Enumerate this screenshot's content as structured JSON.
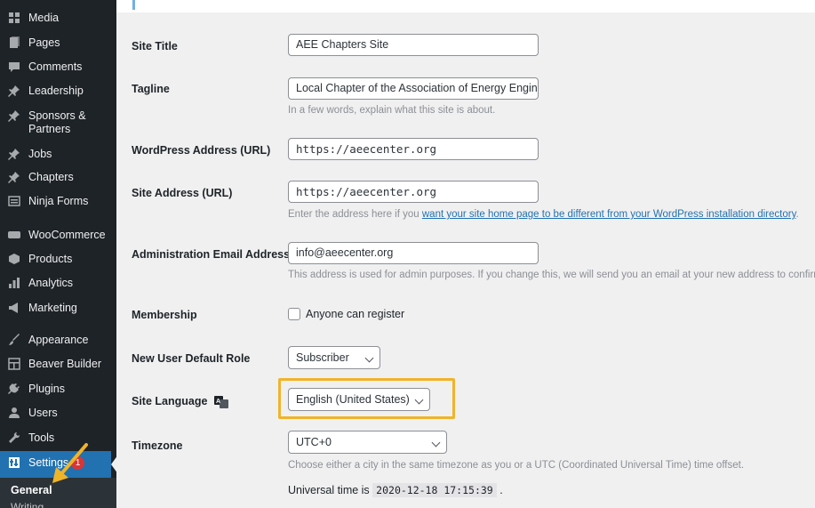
{
  "sidebar": {
    "items": [
      {
        "label": "Media",
        "icon": "media-icon"
      },
      {
        "label": "Pages",
        "icon": "pages-icon"
      },
      {
        "label": "Comments",
        "icon": "comments-icon"
      },
      {
        "label": "Leadership",
        "icon": "pin-icon"
      },
      {
        "label": "Sponsors & Partners",
        "icon": "pin-icon"
      },
      {
        "label": "Jobs",
        "icon": "pin-icon"
      },
      {
        "label": "Chapters",
        "icon": "pin-icon"
      },
      {
        "label": "Ninja Forms",
        "icon": "forms-icon"
      },
      {
        "label": "WooCommerce",
        "icon": "woo-icon"
      },
      {
        "label": "Products",
        "icon": "products-icon"
      },
      {
        "label": "Analytics",
        "icon": "analytics-icon"
      },
      {
        "label": "Marketing",
        "icon": "megaphone-icon"
      },
      {
        "label": "Appearance",
        "icon": "brush-icon"
      },
      {
        "label": "Beaver Builder",
        "icon": "layout-icon"
      },
      {
        "label": "Plugins",
        "icon": "plug-icon"
      },
      {
        "label": "Users",
        "icon": "user-icon"
      },
      {
        "label": "Tools",
        "icon": "wrench-icon"
      }
    ],
    "settings": {
      "label": "Settings",
      "badge": "1"
    },
    "submenu": {
      "general": "General",
      "writing": "Writing"
    }
  },
  "form": {
    "site_title": {
      "label": "Site Title",
      "value": "AEE Chapters Site"
    },
    "tagline": {
      "label": "Tagline",
      "value": "Local Chapter of the Association of Energy Engineers",
      "desc": "In a few words, explain what this site is about."
    },
    "wp_address": {
      "label": "WordPress Address (URL)",
      "value": "https://aeecenter.org"
    },
    "site_address": {
      "label": "Site Address (URL)",
      "value": "https://aeecenter.org",
      "desc_prefix": "Enter the address here if you ",
      "desc_link": "want your site home page to be different from your WordPress installation directory",
      "desc_suffix": "."
    },
    "admin_email": {
      "label": "Administration Email Address",
      "value": "info@aeecenter.org",
      "desc": "This address is used for admin purposes. If you change this, we will send you an email at your new address to confirm it."
    },
    "membership": {
      "label": "Membership",
      "checkbox": "Anyone can register"
    },
    "default_role": {
      "label": "New User Default Role",
      "value": "Subscriber"
    },
    "site_language": {
      "label": "Site Language",
      "value": "English (United States)"
    },
    "timezone": {
      "label": "Timezone",
      "value": "UTC+0",
      "desc": "Choose either a city in the same timezone as you or a UTC (Coordinated Universal Time) time offset.",
      "universal_prefix": "Universal time is",
      "universal_time": "2020-12-18 17:15:39",
      "universal_suffix": "."
    }
  },
  "colors": {
    "sidebar_bg": "#1d2327",
    "active": "#2271b1",
    "highlight": "#f0b429",
    "badge": "#d63638",
    "link": "#2271b1"
  }
}
